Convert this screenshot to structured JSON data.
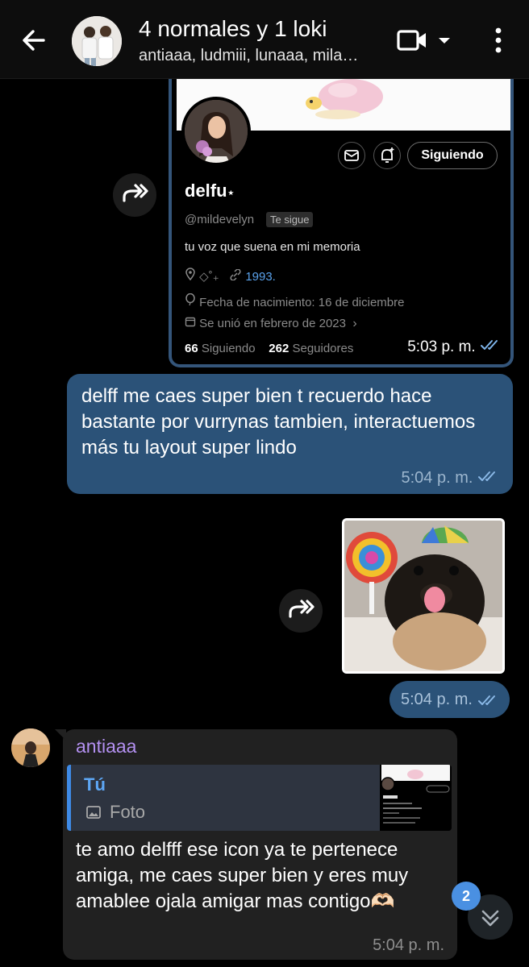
{
  "header": {
    "title": "4 normales y 1 loki",
    "subtitle": "antiaaa, ludmiii, lunaaa, mila…"
  },
  "profile_card": {
    "name": "delfu",
    "name_star": "⋆",
    "handle": "@mildevelyn",
    "follows_you": "Te sigue",
    "follow_button": "Siguiendo",
    "bio": "tu voz que suena en mi memoria",
    "location_text": "◇˚₊",
    "link": "1993.",
    "birthday": "Fecha de nacimiento: 16 de diciembre",
    "joined": "Se unió en febrero de 2023",
    "following_count": "66",
    "following_label": "Siguiendo",
    "followers_count": "262",
    "followers_label": "Seguidores",
    "time": "5:03 p. m."
  },
  "outgoing_message": {
    "text": "delff me caes super bien t recuerdo hace bastante por vurrynas tambien, interactuemos más tu layout super lindo",
    "time": "5:04 p. m."
  },
  "photo_message": {
    "time": "5:04 p. m."
  },
  "incoming_message": {
    "sender": "antiaaa",
    "reply_name": "Tú",
    "reply_type": "Foto",
    "text": "te amo delfff ese icon ya te pertenece amiga, me caes super bien y eres muy amablee ojala amigar mas contigo🫶🏻",
    "time": "5:04 p. m."
  },
  "scroll_badge": "2",
  "colors": {
    "outgoing_bubble": "#2b5278",
    "incoming_bubble": "#212121",
    "sender_name": "#b390f0",
    "reply_accent": "#3e8ae6",
    "link": "#5aa2ec"
  }
}
